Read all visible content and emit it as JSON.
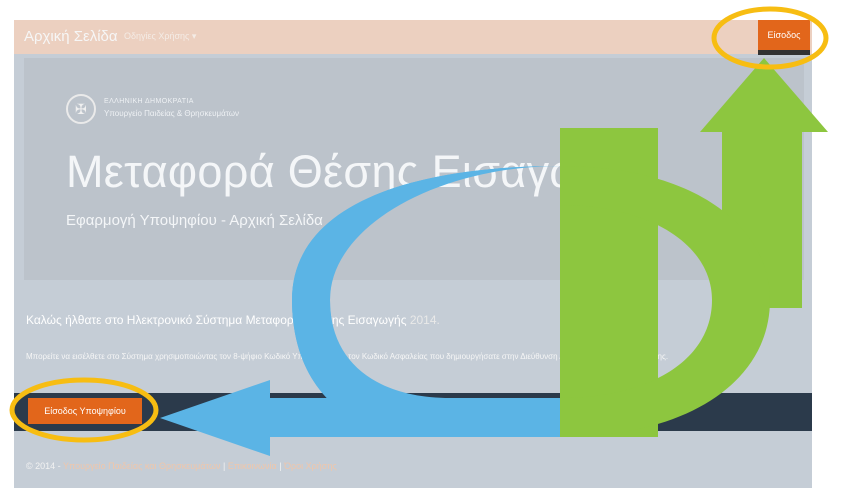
{
  "navbar": {
    "brand": "Αρχική Σελίδα",
    "menu_label": "Οδηγίες Χρήσης ▾",
    "login_label": "Είσοδος"
  },
  "header": {
    "ministry_line1": "ΕΛΛΗΝΙΚΗ ΔΗΜΟΚΡΑΤΙΑ",
    "ministry_line2": "Υπουργείο Παιδείας & Θρησκευμάτων",
    "title": "Μεταφορά Θέσης Εισαγωγής",
    "subtitle": "Εφαρμογή Υποψηφίου - Αρχική Σελίδα"
  },
  "main": {
    "welcome_text": "Καλώς ήλθατε στο Ηλεκτρονικό Σύστημα Μεταφοράς Θέσης Εισαγωγής",
    "welcome_year": "2014.",
    "instructions": "Μπορείτε να εισέλθετε στο Σύστημα χρησιμοποιώντας τον 8-ψήφιο Κωδικό Υποψηφίου και τον Κωδικό Ασφαλείας που δημιουργήσατε στην Διεύθυνση Δευτεροβάθμιας Εκπαίδευσης.",
    "candidate_button": "Είσοδος Υποψηφίου"
  },
  "footer": {
    "copyright": "© 2014 -",
    "ministry_link": "Υπουργείο Παιδείας και Θρησκευμάτων",
    "sep1": "|",
    "contact_link": "Επικοινωνία",
    "sep2": "|",
    "terms_link": "Όροι Χρήσης"
  },
  "colors": {
    "accent": "#e2661b",
    "highlight_ring": "#f7bd12",
    "arrow_green": "#8dc63f",
    "arrow_blue": "#5bb4e5",
    "dark_band": "#2b3a4b"
  }
}
